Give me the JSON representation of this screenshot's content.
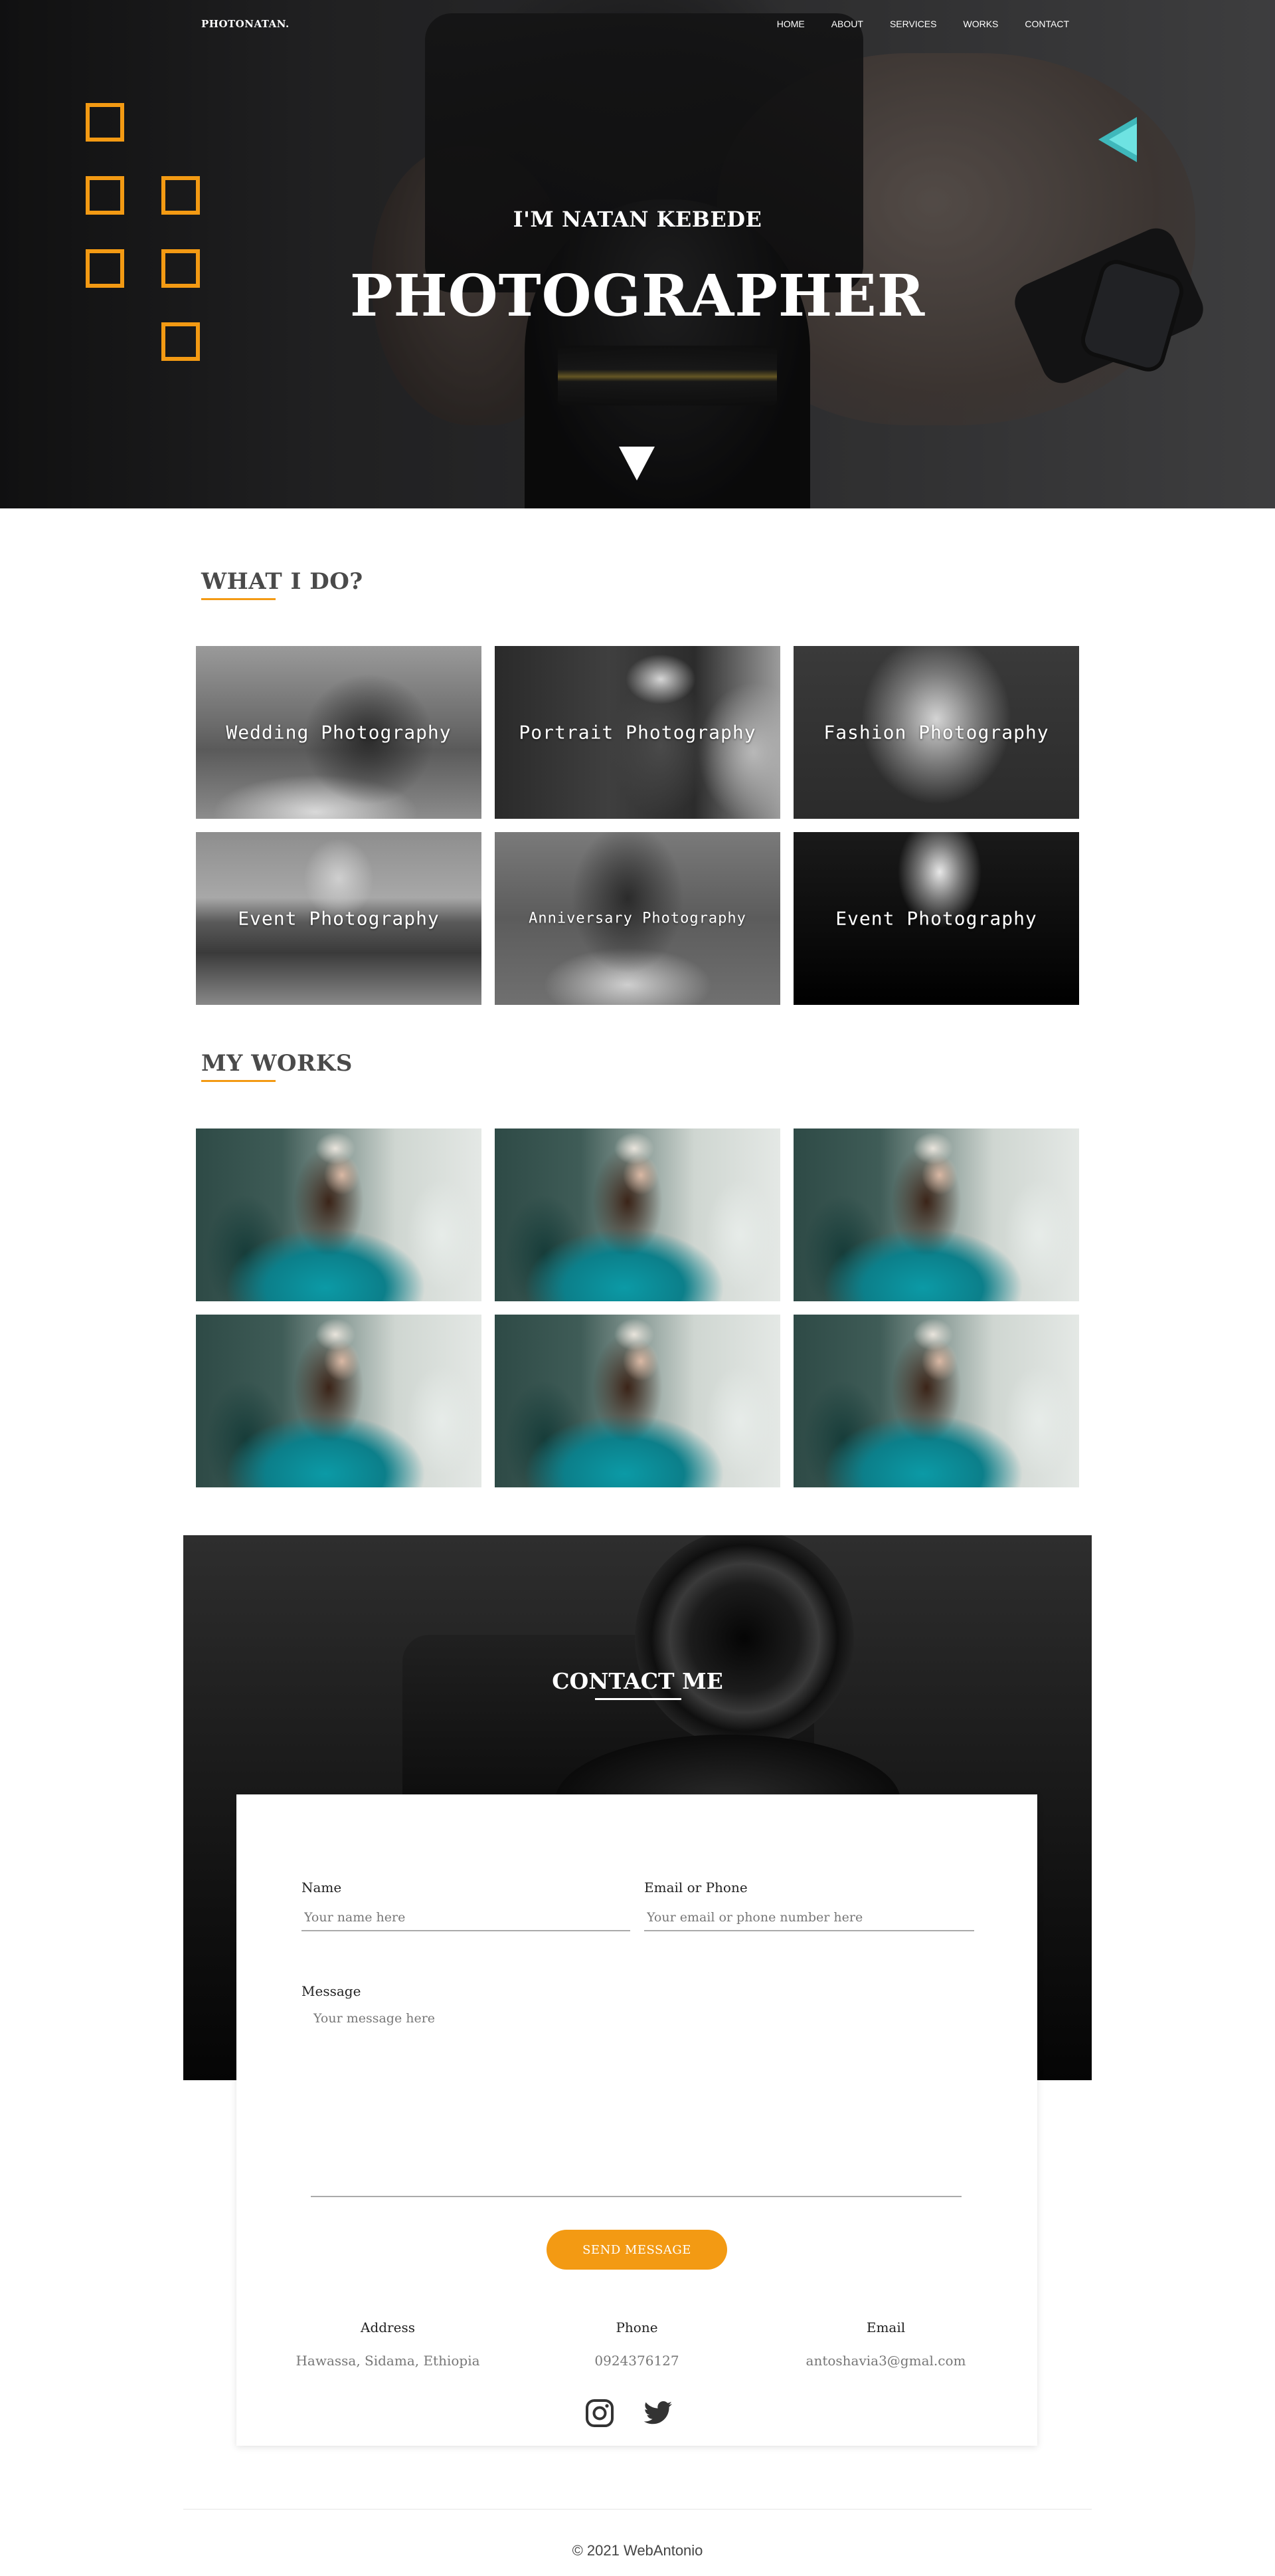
{
  "brand": {
    "logo": "PHOTONATAN.",
    "accent": "#f39a13",
    "arrow_color": "#54d1d1"
  },
  "nav": {
    "items": [
      "HOME",
      "ABOUT",
      "SERVICES",
      "WORKS",
      "CONTACT"
    ]
  },
  "hero": {
    "subtitle": "I'M NATAN KEBEDE",
    "title": "PHOTOGRAPHER",
    "scroll_icon": "triangle-down-icon",
    "deco_icon": "double-chevron-left-icon"
  },
  "services": {
    "title": "WHAT I DO?",
    "items": [
      {
        "label": "Wedding Photography"
      },
      {
        "label": "Portrait Photography"
      },
      {
        "label": "Fashion Photography"
      },
      {
        "label": "Event Photography"
      },
      {
        "label": "Anniversary Photography"
      },
      {
        "label": "Event Photography"
      }
    ]
  },
  "works": {
    "title": "MY WORKS",
    "count": 6
  },
  "contact": {
    "title": "CONTACT ME",
    "name_label": "Name",
    "name_placeholder": "Your name here",
    "email_label": "Email or Phone",
    "email_placeholder": "Your email or phone number here",
    "message_label": "Message",
    "message_placeholder": "Your message here",
    "send_label": "SEND MESSAGE",
    "info": [
      {
        "head": "Address",
        "value": "Hawassa, Sidama, Ethiopia"
      },
      {
        "head": "Phone",
        "value": "0924376127"
      },
      {
        "head": "Email",
        "value": "antoshavia3@gmal.com"
      }
    ],
    "social_icons": [
      "instagram-icon",
      "twitter-icon"
    ]
  },
  "footer": {
    "text": "© 2021 WebAntonio"
  }
}
